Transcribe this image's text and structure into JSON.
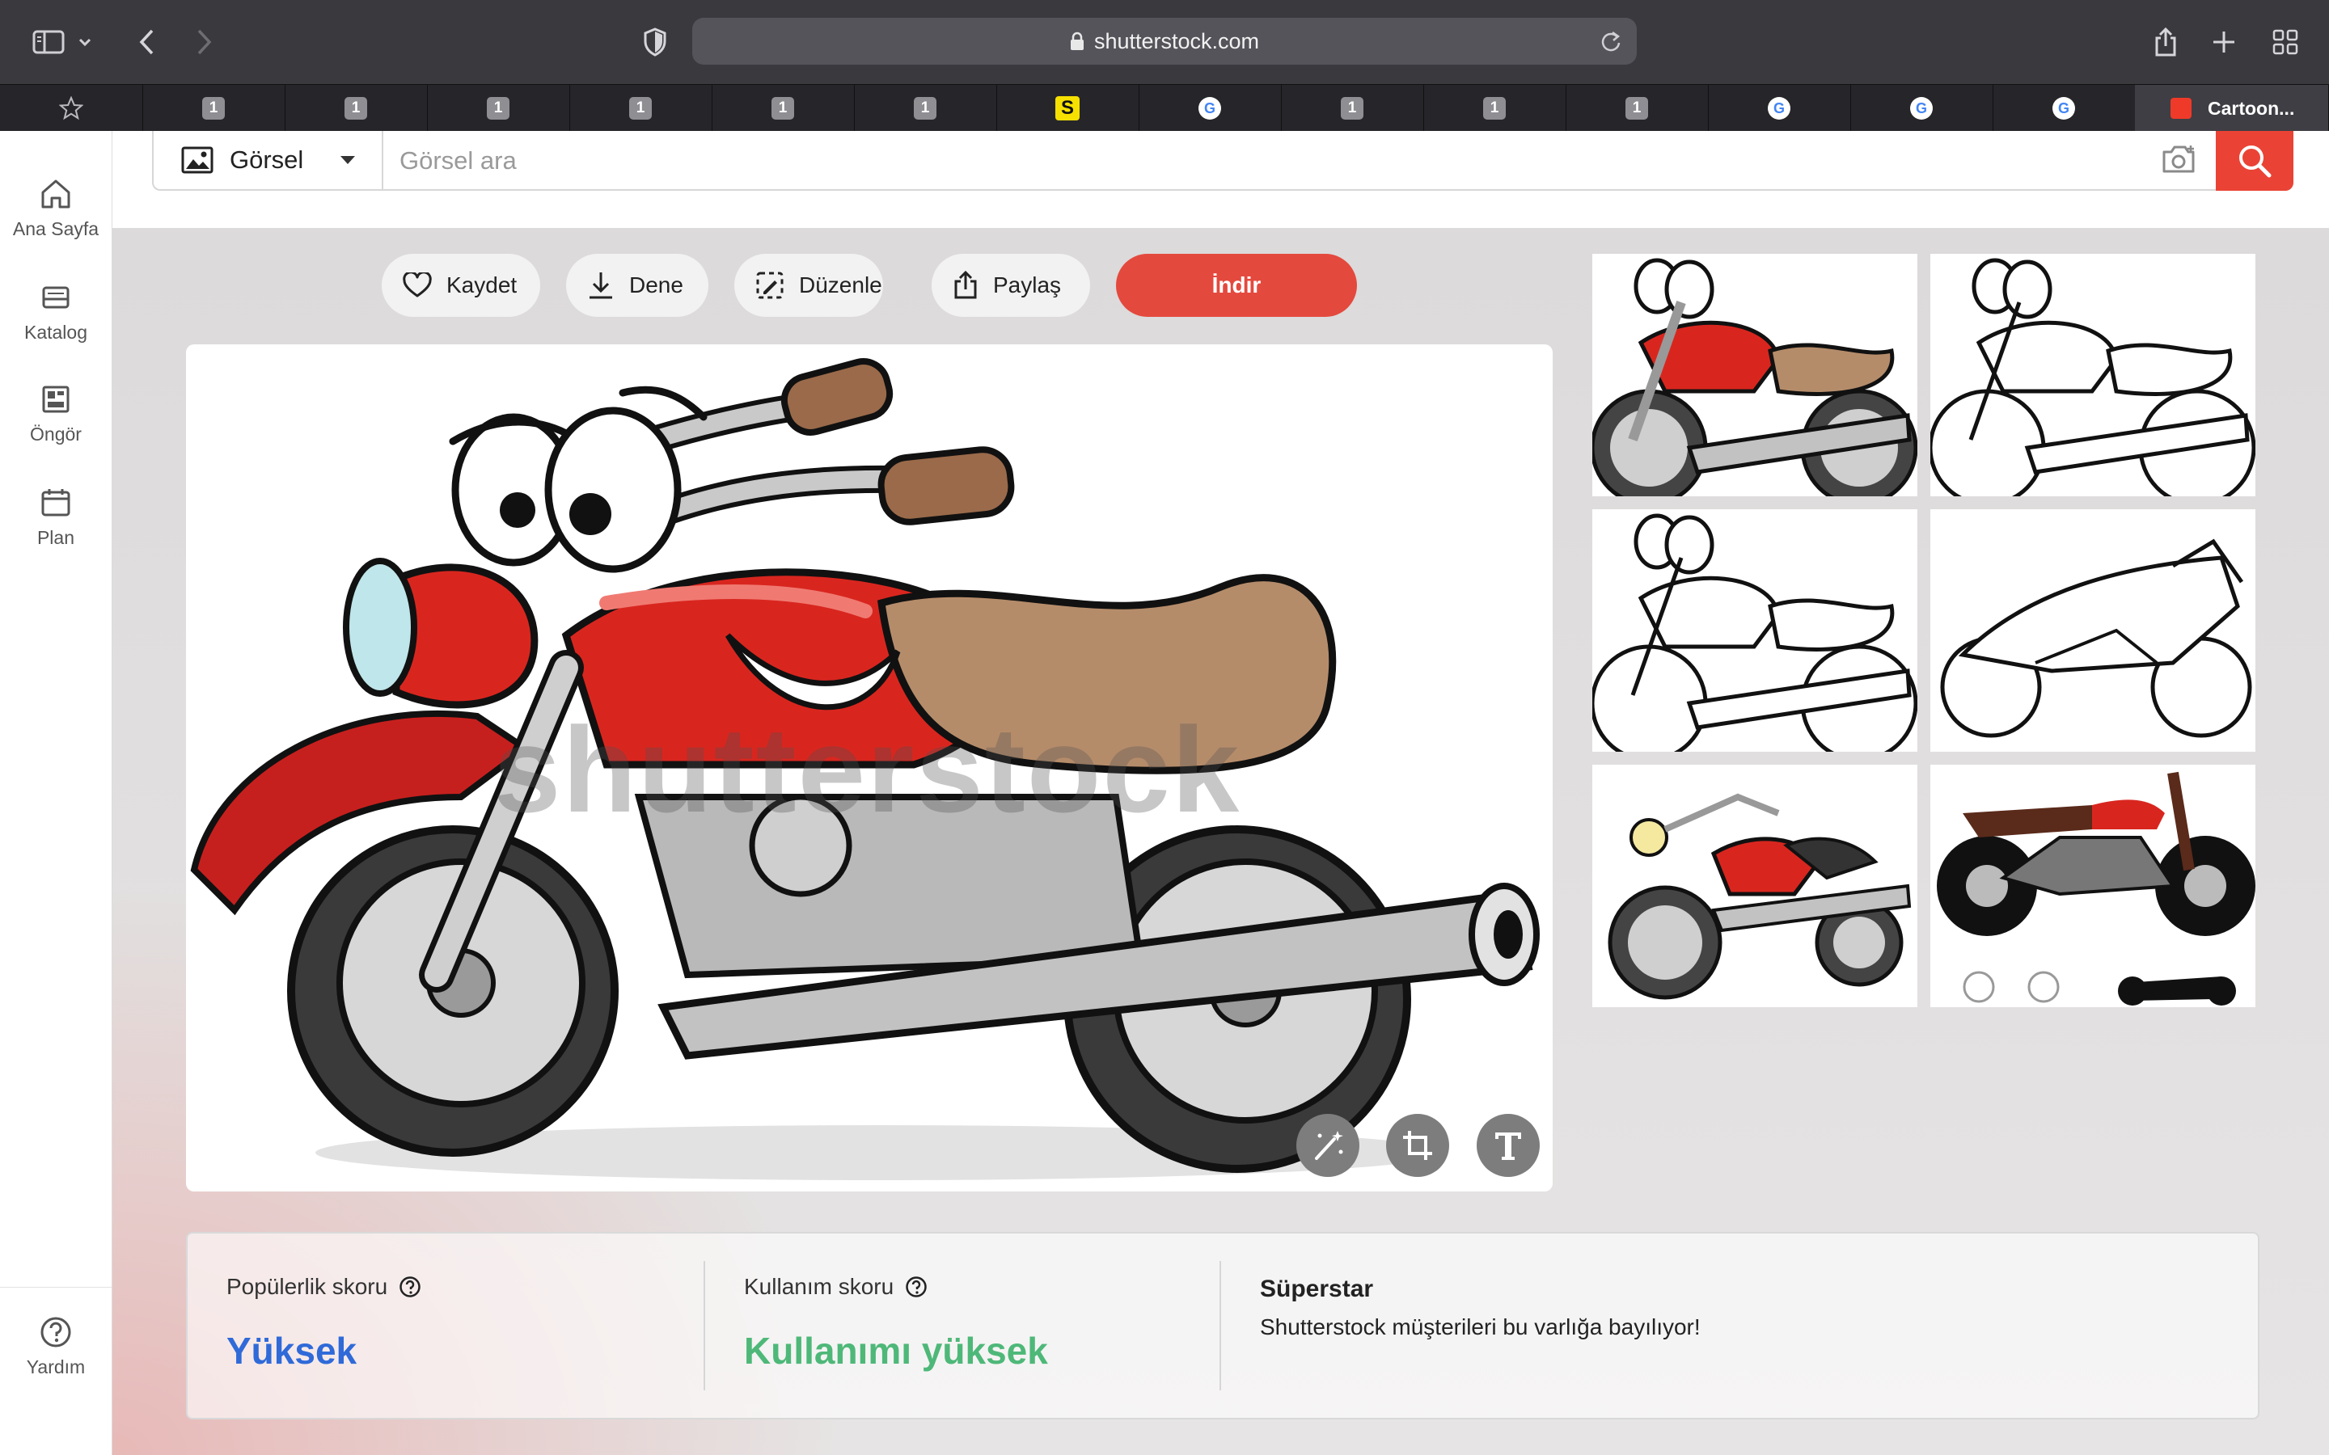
{
  "browser": {
    "url": "shutterstock.com",
    "active_tab_title": "Cartoon...",
    "tab_badges": [
      "1",
      "1",
      "1",
      "1",
      "1",
      "1",
      "S",
      "G",
      "1",
      "1",
      "1",
      "G",
      "G",
      "G"
    ]
  },
  "sidebar": {
    "items": [
      {
        "label": "Ana Sayfa",
        "icon": "home-icon"
      },
      {
        "label": "Katalog",
        "icon": "catalog-icon"
      },
      {
        "label": "Öngör",
        "icon": "insights-icon"
      },
      {
        "label": "Plan",
        "icon": "calendar-icon"
      }
    ],
    "help_label": "Yardım"
  },
  "search": {
    "type_label": "Görsel",
    "placeholder": "Görsel ara",
    "value": ""
  },
  "actions": {
    "save_label": "Kaydet",
    "try_label": "Dene",
    "edit_label": "Düzenle",
    "share_label": "Paylaş",
    "download_label": "İndir"
  },
  "preview": {
    "watermark": "shutterstock",
    "tools": [
      "magic-wand-icon",
      "crop-icon",
      "text-icon"
    ]
  },
  "scores": {
    "popularity_label": "Popülerlik skoru",
    "popularity_value": "Yüksek",
    "usage_label": "Kullanım skoru",
    "usage_value": "Kullanımı yüksek",
    "superstar_title": "Süperstar",
    "superstar_text": "Shutterstock müşterileri bu varlığa bayılıyor!"
  },
  "colors": {
    "brand_red": "#ea4335",
    "popularity_blue": "#2f6ad8",
    "usage_green": "#4eb879"
  }
}
